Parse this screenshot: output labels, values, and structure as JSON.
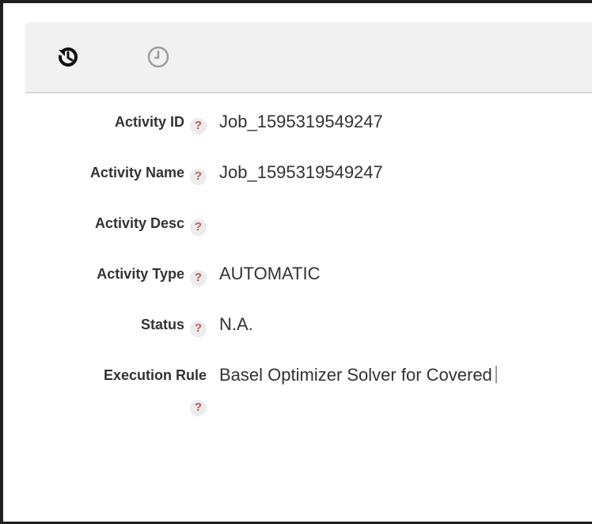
{
  "toolbar": {
    "undo_icon": "history-undo-icon",
    "clock_icon": "clock-icon"
  },
  "fields": [
    {
      "label": "Activity ID",
      "help": "?",
      "value": "Job_1595319549247"
    },
    {
      "label": "Activity Name",
      "help": "?",
      "value": "Job_1595319549247"
    },
    {
      "label": "Activity Desc",
      "help": "?",
      "value": ""
    },
    {
      "label": "Activity Type",
      "help": "?",
      "value": "AUTOMATIC"
    },
    {
      "label": "Status",
      "help": "?",
      "value": "N.A."
    },
    {
      "label": "Execution Rule",
      "help": "?",
      "value": "Basel Optimizer Solver for Covered"
    }
  ],
  "colors": {
    "help_icon": "#c15a5a",
    "toolbar_bg": "#f1f1f1",
    "history_icon": "#9b9b9b"
  }
}
